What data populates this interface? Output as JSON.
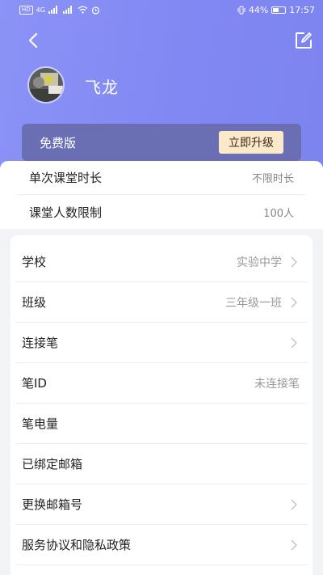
{
  "status_bar": {
    "left_chip": "HD",
    "left_small": "4G",
    "battery": "44%",
    "time": "17:57"
  },
  "colors": {
    "header_gradient_start": "#8b93f6",
    "header_gradient_end": "#7c84f0",
    "plan_bar": "#6a6fb3",
    "upgrade_button_bg": "#fbe9c9"
  },
  "icons": {
    "back": "chevron-left-icon",
    "edit": "edit-icon",
    "row_arrow": "chevron-right-icon"
  },
  "profile": {
    "name": "飞龙"
  },
  "plan": {
    "name": "免费版",
    "upgrade_label": "立即升级"
  },
  "quota": [
    {
      "label": "单次课堂时长",
      "value": "不限时长"
    },
    {
      "label": "课堂人数限制",
      "value": "100人"
    }
  ],
  "settings": [
    {
      "label": "学校",
      "value": "实验中学",
      "arrow": true
    },
    {
      "label": "班级",
      "value": "三年级一班",
      "arrow": true
    },
    {
      "label": "连接笔",
      "value": "",
      "arrow": true
    },
    {
      "label": "笔ID",
      "value": "未连接笔",
      "arrow": false
    },
    {
      "label": "笔电量",
      "value": "",
      "arrow": false
    },
    {
      "label": "已绑定邮箱",
      "value": "",
      "arrow": false
    },
    {
      "label": "更换邮箱号",
      "value": "",
      "arrow": true
    },
    {
      "label": "服务协议和隐私政策",
      "value": "",
      "arrow": true
    }
  ]
}
